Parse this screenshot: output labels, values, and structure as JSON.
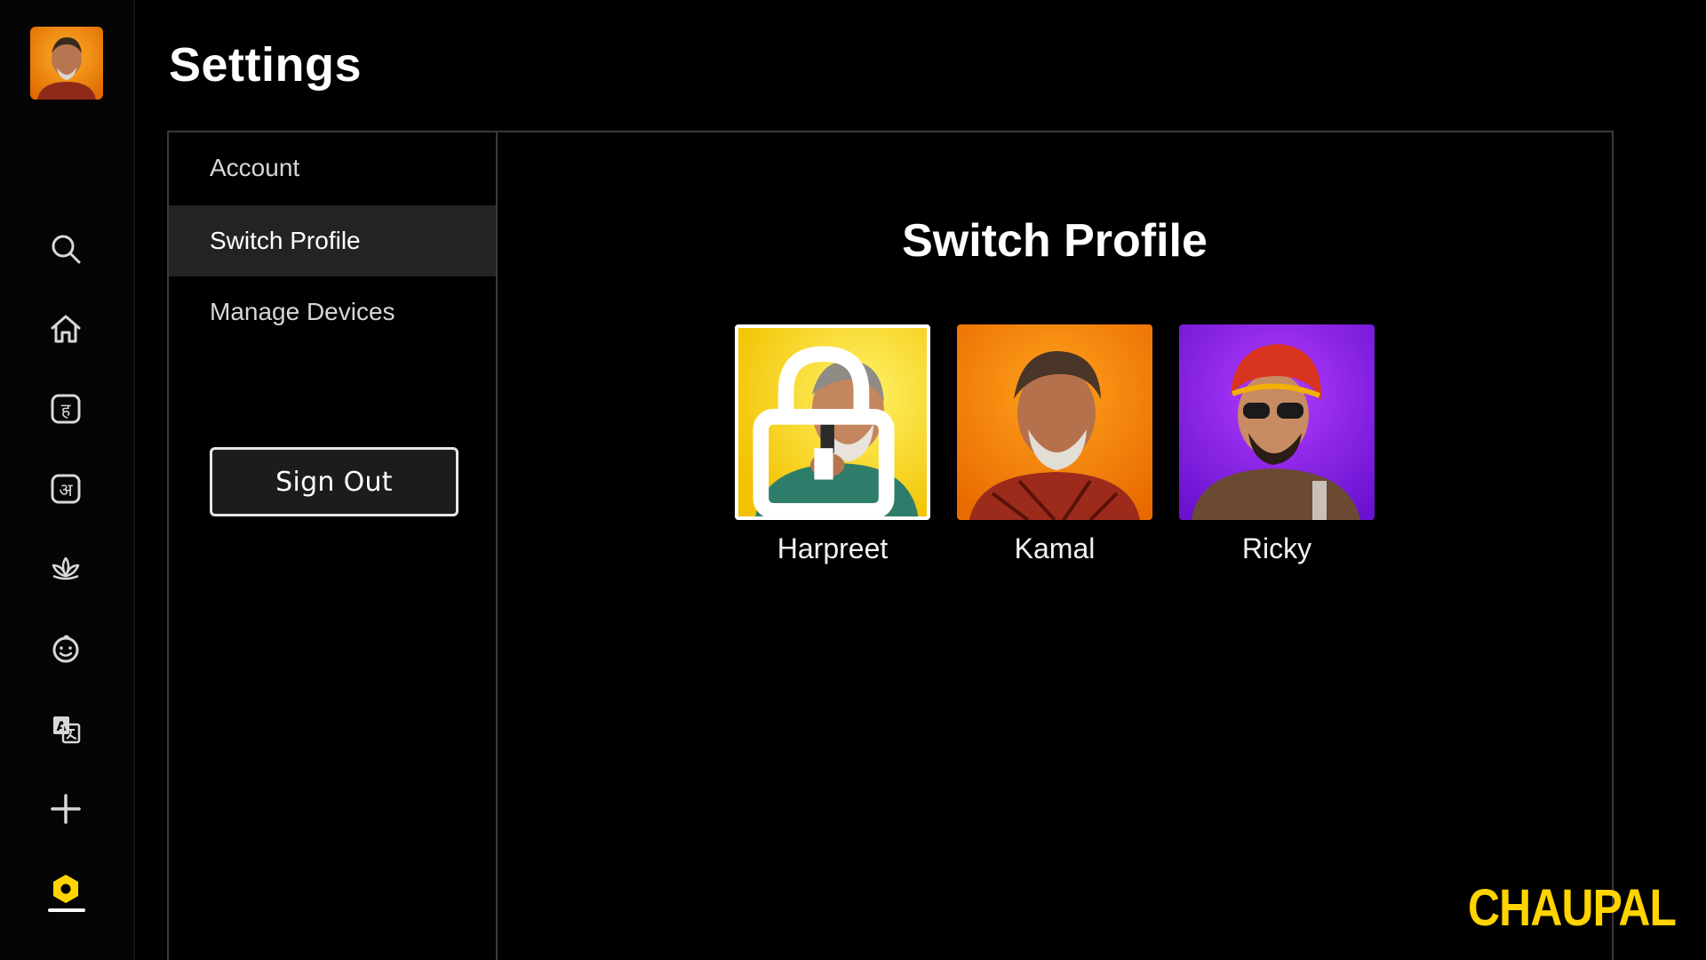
{
  "page": {
    "title": "Settings"
  },
  "rail": {
    "items": [
      {
        "icon": "search-icon"
      },
      {
        "icon": "home-icon"
      },
      {
        "icon": "hindi-letter-icon",
        "glyph": "ह"
      },
      {
        "icon": "devanagari-letter-icon",
        "glyph": "अ"
      },
      {
        "icon": "lotus-icon"
      },
      {
        "icon": "kids-face-icon"
      },
      {
        "icon": "translate-icon"
      },
      {
        "icon": "plus-icon"
      },
      {
        "icon": "settings-gear-icon",
        "active": true
      }
    ]
  },
  "menu": {
    "items": [
      {
        "label": "Account"
      },
      {
        "label": "Switch Profile",
        "active": true
      },
      {
        "label": "Manage Devices"
      }
    ],
    "sign_out_label": "Sign Out"
  },
  "content": {
    "title": "Switch Profile",
    "profiles": [
      {
        "name": "Harpreet",
        "selected": true,
        "locked": true,
        "bg": "#f7d400"
      },
      {
        "name": "Kamal",
        "selected": false,
        "locked": false,
        "bg": "#f08a00"
      },
      {
        "name": "Ricky",
        "selected": false,
        "locked": false,
        "bg": "#8a1ee0"
      }
    ]
  },
  "brand": {
    "logo_text": "CHAUPAL"
  },
  "colors": {
    "background": "#000000",
    "accent": "#ffd400",
    "menu_active_bg": "#232323",
    "panel_border": "#3a3a3a"
  }
}
